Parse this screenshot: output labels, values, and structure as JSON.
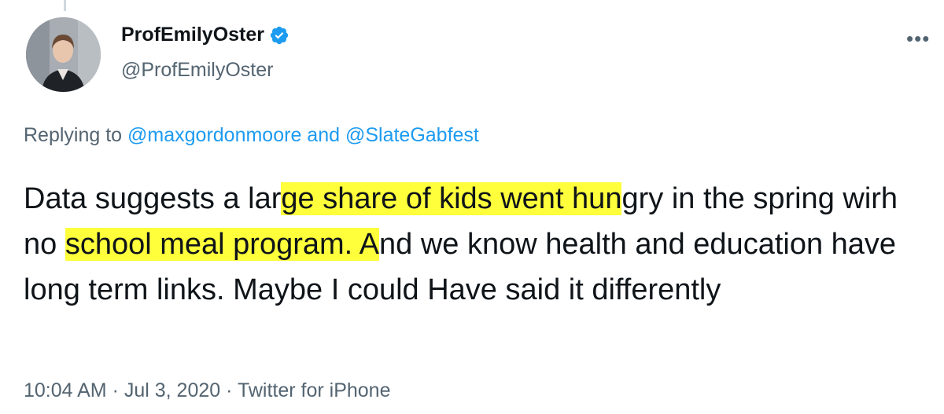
{
  "author": {
    "display_name": "ProfEmilyOster",
    "handle": "@ProfEmilyOster",
    "verified": true,
    "avatar_icon": "profile-photo"
  },
  "more_icon": "more-dots-icon",
  "reply": {
    "prefix": "Replying to ",
    "mention_1": "@maxgordonmoore",
    "joiner": " and ",
    "mention_2": "@SlateGabfest"
  },
  "tweet": {
    "seg1": "Data suggests a lar",
    "hl1": "ge share of kids went hun",
    "seg2": "gry in the spring wirh no ",
    "hl2": "school meal program. A",
    "seg3": "nd we know health and education have long term links. Maybe I could Have said it differently"
  },
  "meta": {
    "time": "10:04 AM",
    "date": "Jul 3, 2020",
    "source": "Twitter for iPhone",
    "sep": " · "
  },
  "colors": {
    "highlight": "#ffff3c",
    "link": "#1d9bf0",
    "secondary_text": "#536471",
    "verified_badge": "#1d9bf0"
  }
}
